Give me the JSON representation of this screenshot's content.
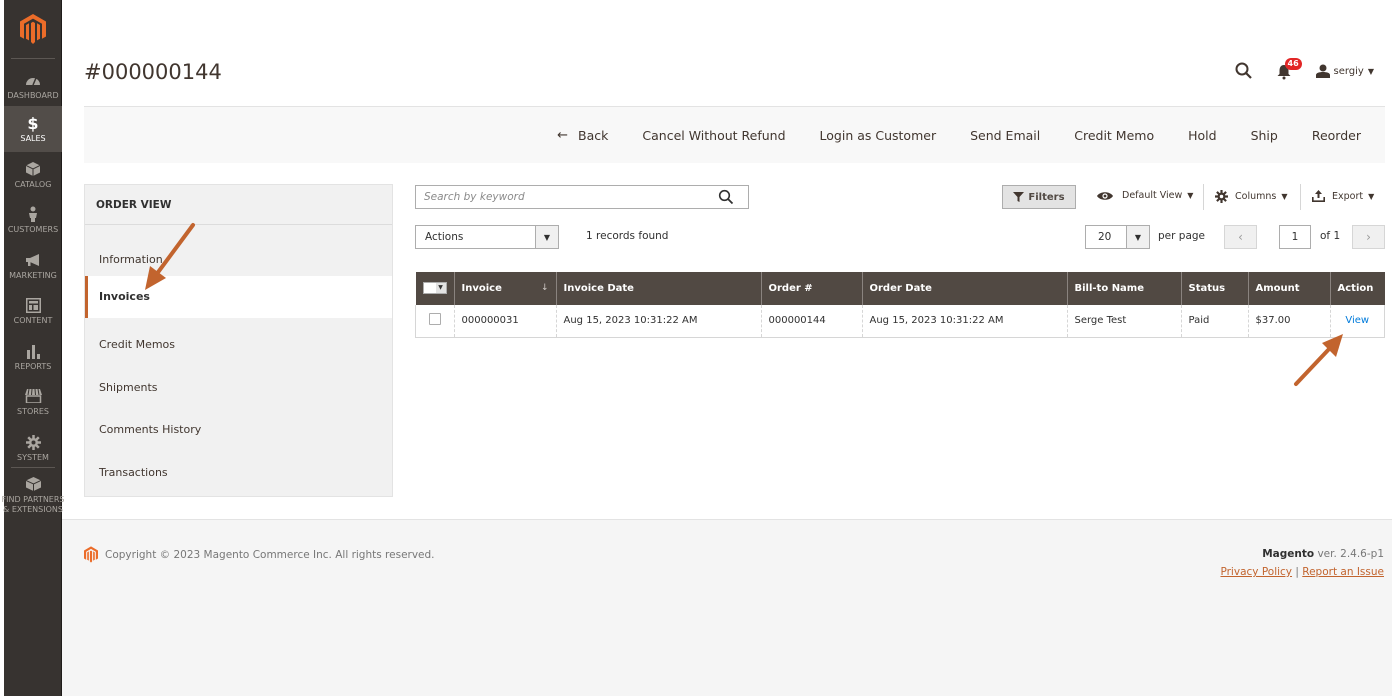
{
  "nav": {
    "items": [
      {
        "label": "DASHBOARD",
        "icon": "dashboard-gauge-icon"
      },
      {
        "label": "SALES",
        "icon": "dollar-icon",
        "active": true
      },
      {
        "label": "CATALOG",
        "icon": "box-icon"
      },
      {
        "label": "CUSTOMERS",
        "icon": "person-icon"
      },
      {
        "label": "MARKETING",
        "icon": "megaphone-icon"
      },
      {
        "label": "CONTENT",
        "icon": "layout-icon"
      },
      {
        "label": "REPORTS",
        "icon": "bar-chart-icon"
      },
      {
        "label": "STORES",
        "icon": "storefront-icon"
      },
      {
        "label": "SYSTEM",
        "icon": "gear-icon"
      },
      {
        "label": "FIND PARTNERS",
        "label2": "& EXTENSIONS",
        "icon": "partners-cube-icon"
      }
    ]
  },
  "header": {
    "title": "#000000144",
    "notifications_count": "46",
    "username": "sergiy"
  },
  "toolbar": {
    "back": "Back",
    "buttons": [
      "Cancel Without Refund",
      "Login as Customer",
      "Send Email",
      "Credit Memo",
      "Hold",
      "Ship",
      "Reorder"
    ]
  },
  "order_view": {
    "title": "ORDER VIEW",
    "tabs": [
      "Information",
      "Invoices",
      "Credit Memos",
      "Shipments",
      "Comments History",
      "Transactions"
    ],
    "active_tab": "Invoices"
  },
  "grid": {
    "search_placeholder": "Search by keyword",
    "filters_label": "Filters",
    "view_label": "Default View",
    "columns_label": "Columns",
    "export_label": "Export",
    "actions_label": "Actions",
    "records_found": "1 records found",
    "per_page_value": "20",
    "per_page_label": "per page",
    "page_current": "1",
    "page_of": "of 1",
    "columns": [
      "Invoice",
      "Invoice Date",
      "Order #",
      "Order Date",
      "Bill-to Name",
      "Status",
      "Amount",
      "Action"
    ],
    "rows": [
      {
        "invoice": "000000031",
        "invoice_date": "Aug 15, 2023 10:31:22 AM",
        "order": "000000144",
        "order_date": "Aug 15, 2023 10:31:22 AM",
        "bill_to": "Serge Test",
        "status": "Paid",
        "amount": "$37.00",
        "action": "View"
      }
    ]
  },
  "footer": {
    "copyright": "Copyright © 2023 Magento Commerce Inc. All rights reserved.",
    "brand": "Magento",
    "version": " ver. 2.4.6-p1",
    "privacy": "Privacy Policy",
    "separator": "|",
    "report": "Report an Issue"
  },
  "colors": {
    "accent": "#c2642e",
    "sidebar": "#373330",
    "table_header": "#514943",
    "link": "#007bdb",
    "annotation_arrow": "#c2642e"
  }
}
